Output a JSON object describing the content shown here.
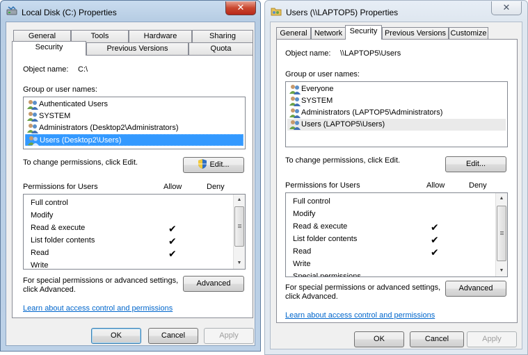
{
  "left": {
    "title": "Local Disk (C:) Properties",
    "close_glyph": "✕",
    "tabs_row1": [
      "General",
      "Tools",
      "Hardware",
      "Sharing"
    ],
    "tabs_row2": [
      "Security",
      "Previous Versions",
      "Quota"
    ],
    "active_tab": "Security",
    "object_label": "Object name:",
    "object_value": "C:\\",
    "group_label": "Group or user names:",
    "users": [
      "Authenticated Users",
      "SYSTEM",
      "Administrators (Desktop2\\Administrators)",
      "Users (Desktop2\\Users)"
    ],
    "selected_user": "Users (Desktop2\\Users)",
    "change_text": "To change permissions, click Edit.",
    "edit_button": "Edit...",
    "permissions_label": "Permissions for Users",
    "allow_label": "Allow",
    "deny_label": "Deny",
    "permissions": [
      "Full control",
      "Modify",
      "Read & execute",
      "List folder contents",
      "Read",
      "Write"
    ],
    "allow_checked": [
      false,
      false,
      true,
      true,
      true,
      false
    ],
    "special_text_1": "For special permissions or advanced settings,",
    "special_text_2": "click Advanced.",
    "advanced_button": "Advanced",
    "learn_link": "Learn about access control and permissions",
    "ok_button": "OK",
    "cancel_button": "Cancel",
    "apply_button": "Apply",
    "check_glyph": "✔"
  },
  "right": {
    "title": "Users (\\\\LAPTOP5) Properties",
    "close_glyph": "✕",
    "tabs": [
      "General",
      "Network",
      "Security",
      "Previous Versions",
      "Customize"
    ],
    "active_tab": "Security",
    "object_label": "Object name:",
    "object_value": "\\\\LAPTOP5\\Users",
    "group_label": "Group or user names:",
    "users": [
      "Everyone",
      "SYSTEM",
      "Administrators (LAPTOP5\\Administrators)",
      "Users (LAPTOP5\\Users)"
    ],
    "selected_user": "Users (LAPTOP5\\Users)",
    "change_text": "To change permissions, click Edit.",
    "edit_button": "Edit...",
    "permissions_label": "Permissions for Users",
    "allow_label": "Allow",
    "deny_label": "Deny",
    "permissions": [
      "Full control",
      "Modify",
      "Read & execute",
      "List folder contents",
      "Read",
      "Write",
      "Special permissions"
    ],
    "allow_checked": [
      false,
      false,
      true,
      true,
      true,
      false,
      false
    ],
    "special_text_1": "For special permissions or advanced settings,",
    "special_text_2": "click Advanced.",
    "advanced_button": "Advanced",
    "learn_link": "Learn about access control and permissions",
    "ok_button": "OK",
    "cancel_button": "Cancel",
    "apply_button": "Apply",
    "check_glyph": "✔"
  },
  "colors": {
    "selection": "#3399ff",
    "link": "#0066cc",
    "close_red": "#c9472f"
  }
}
